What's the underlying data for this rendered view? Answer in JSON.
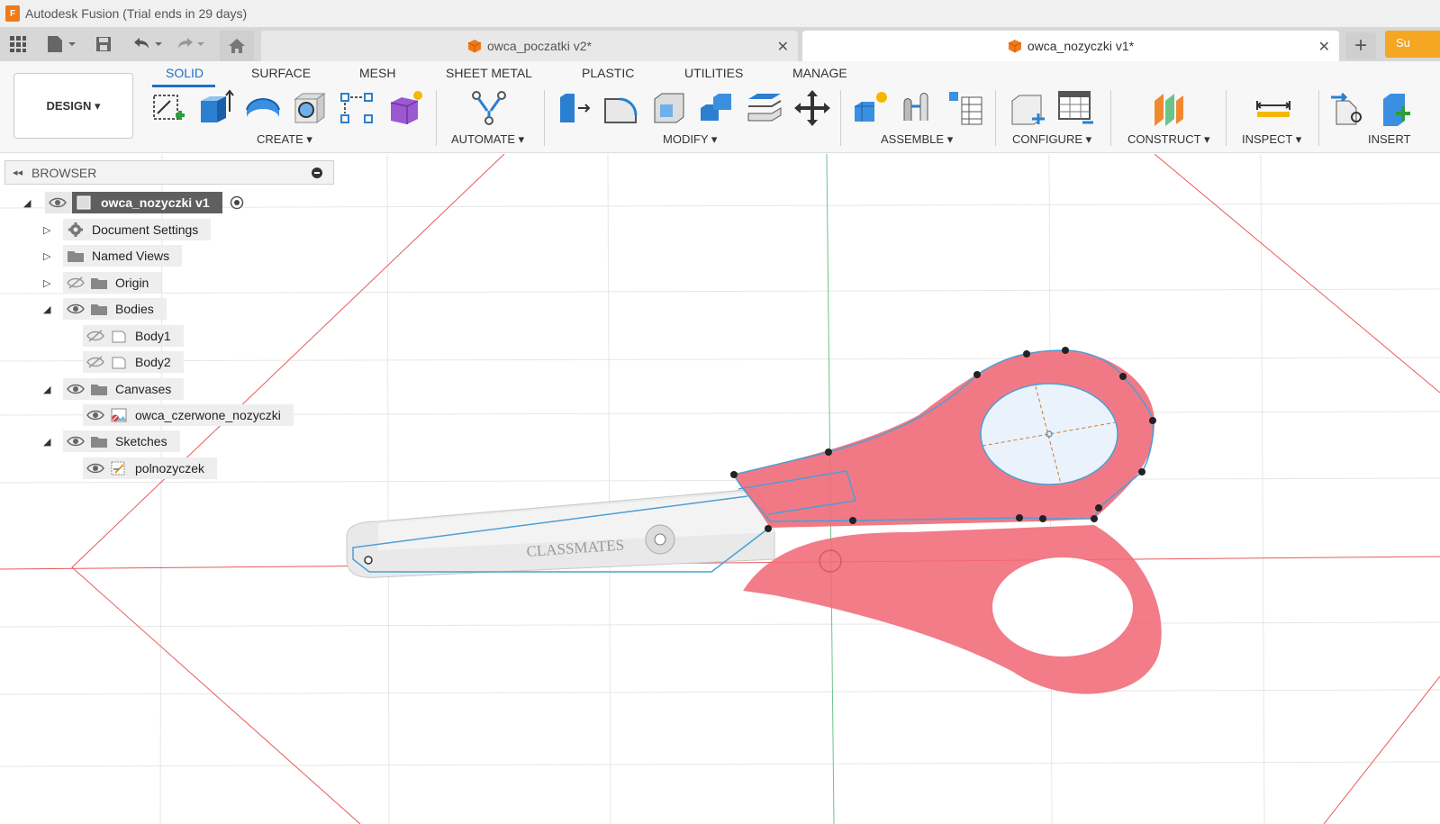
{
  "app": {
    "title": "Autodesk Fusion (Trial ends in 29 days)",
    "logo_text": "F"
  },
  "tabs": [
    {
      "label": "owca_poczatki v2*",
      "active": false
    },
    {
      "label": "owca_nozyczki v1*",
      "active": true
    }
  ],
  "tab_close_glyph": "✕",
  "add_tab_glyph": "+",
  "subscribe_label": "Su",
  "design_label": "DESIGN ▾",
  "ribbon_tabs": [
    "SOLID",
    "SURFACE",
    "MESH",
    "SHEET METAL",
    "PLASTIC",
    "UTILITIES",
    "MANAGE"
  ],
  "ribbon_sections": [
    "CREATE ▾",
    "AUTOMATE ▾",
    "MODIFY ▾",
    "ASSEMBLE ▾",
    "CONFIGURE ▾",
    "CONSTRUCT ▾",
    "INSPECT ▾",
    "INSERT"
  ],
  "browser": {
    "title": "BROWSER",
    "collapse_glyph": "◂◂",
    "root": "owca_nozyczki v1",
    "nodes": [
      {
        "label": "Document Settings",
        "icon": "gear-icon",
        "visibility": "none",
        "expander": "▷"
      },
      {
        "label": "Named Views",
        "icon": "folder-icon",
        "visibility": "none",
        "expander": "▷"
      },
      {
        "label": "Origin",
        "icon": "folder-icon",
        "visibility": "hidden",
        "expander": "▷"
      },
      {
        "label": "Bodies",
        "icon": "folder-icon",
        "visibility": "visible",
        "expander": "◢"
      },
      {
        "label": "Body1",
        "icon": "body-icon",
        "visibility": "hidden",
        "expander": ""
      },
      {
        "label": "Body2",
        "icon": "body-icon",
        "visibility": "hidden",
        "expander": ""
      },
      {
        "label": "Canvases",
        "icon": "folder-icon",
        "visibility": "visible",
        "expander": "◢"
      },
      {
        "label": "owca_czerwone_nozyczki",
        "icon": "canvas-image-icon",
        "visibility": "visible",
        "expander": ""
      },
      {
        "label": "Sketches",
        "icon": "folder-icon",
        "visibility": "visible",
        "expander": "◢"
      },
      {
        "label": "polnozyczek",
        "icon": "sketch-icon",
        "visibility": "visible",
        "expander": ""
      }
    ]
  },
  "canvas_text": "CLASSMATES",
  "colors": {
    "accent": "#1d70c1",
    "handle_red": "#f06a78",
    "sketch_blue": "#4a9fd8",
    "axis_red": "#e85a5a",
    "axis_green": "#6cc48a"
  }
}
